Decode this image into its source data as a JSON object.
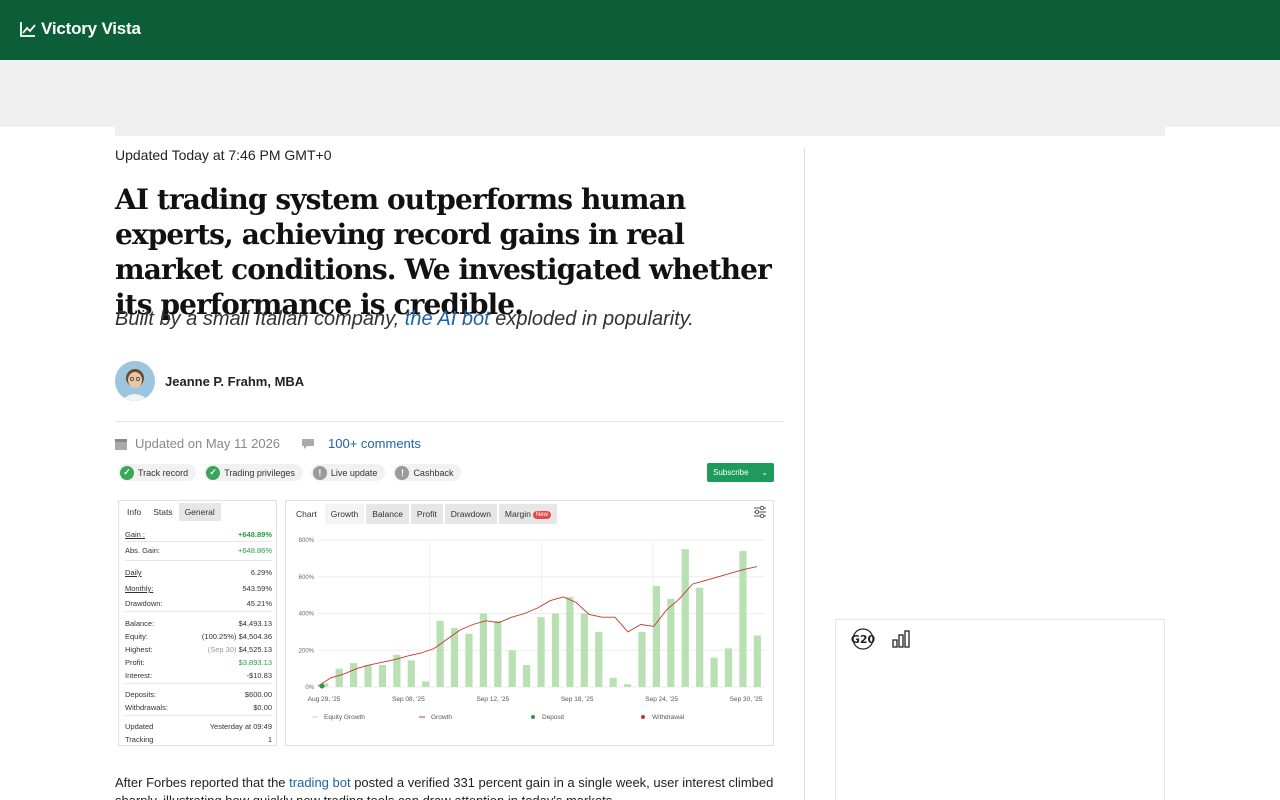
{
  "brand": {
    "name": "Victory Vista"
  },
  "article": {
    "updated_top": "Updated Today at 7:46 PM GMT+0",
    "headline": "AI trading system outperforms human experts, achieving record gains in real market conditions. We investigated whether its performance is credible.",
    "subhead_pre": "Built by a small Italian company, ",
    "subhead_link": "the AI bot",
    "subhead_post": " exploded in popularity.",
    "author": "Jeanne P. Frahm, MBA",
    "updated_on": "Updated on May 11 2026",
    "comments": "100+ comments",
    "body_pre": "After Forbes reported that the ",
    "body_link": "trading bot",
    "body_post": " posted a verified 331 percent gain in a single week, user interest climbed sharply, illustrating how quickly new trading tools can draw attention in today's markets."
  },
  "widget": {
    "badges": [
      "Track record",
      "Trading privileges",
      "Live update",
      "Cashback"
    ],
    "subscribe": "Subscribe",
    "stats_tabs": [
      "Info",
      "Stats",
      "General"
    ],
    "stats": [
      {
        "k": "Gain :",
        "v": "+648.89%"
      },
      {
        "k": "Abs. Gain:",
        "v": "+648.86%"
      },
      {
        "k": "Daily",
        "v": "6.29%"
      },
      {
        "k": "Monthly:",
        "v": "543.59%"
      },
      {
        "k": "Drawdown:",
        "v": "45.21%"
      },
      {
        "k": "Balance:",
        "v": "$4,493.13"
      },
      {
        "k": "Equity:",
        "v_pre": "(100.25%)",
        "v": "$4,504.36"
      },
      {
        "k": "Highest:",
        "v_pre": "(Sep 30)",
        "v": "$4,525.13"
      },
      {
        "k": "Profit:",
        "v": "$3,893.13"
      },
      {
        "k": "Interest:",
        "v": "-$10.83"
      },
      {
        "k": "Deposits:",
        "v": "$600.00"
      },
      {
        "k": "Withdrawals:",
        "v": "$0.00"
      },
      {
        "k": "Updated",
        "v": "Yesterday at 09:49"
      },
      {
        "k": "Tracking",
        "v": "1"
      }
    ],
    "chart_tabs": [
      "Chart",
      "Growth",
      "Balance",
      "Profit",
      "Drawdown",
      "Margin"
    ],
    "new_tag": "New"
  },
  "chart_data": {
    "type": "bar",
    "y_ticks": [
      "800%",
      "600%",
      "400%",
      "200%",
      "0%"
    ],
    "ylim": [
      0,
      800
    ],
    "x_ticks": [
      "Aug 29, '25",
      "Sep 08, '25",
      "Sep 12, '25",
      "Sep 18, '25",
      "Sep 24, '25",
      "Sep 30, '25"
    ],
    "equity_bars": [
      20,
      100,
      130,
      120,
      120,
      175,
      145,
      30,
      360,
      320,
      290,
      400,
      360,
      200,
      120,
      380,
      400,
      490,
      400,
      300,
      50,
      15,
      300,
      550,
      480,
      750,
      540,
      160,
      210,
      740,
      280
    ],
    "growth_line": [
      5,
      50,
      70,
      100,
      120,
      135,
      150,
      170,
      185,
      210,
      260,
      310,
      340,
      360,
      350,
      380,
      400,
      430,
      470,
      490,
      460,
      395,
      380,
      380,
      300,
      340,
      330,
      420,
      480,
      560,
      580,
      600,
      620,
      640,
      655
    ],
    "deposit_points": [
      [
        0,
        5
      ]
    ],
    "legend": [
      "Equity Growth",
      "Growth",
      "Deposit",
      "Withdrawal"
    ]
  },
  "colors": {
    "brand_green": "#0b5e37",
    "link": "#1f62a8",
    "bar": "#b9e0b3",
    "growth": "#c0392b",
    "deposit": "#2a9c45"
  }
}
